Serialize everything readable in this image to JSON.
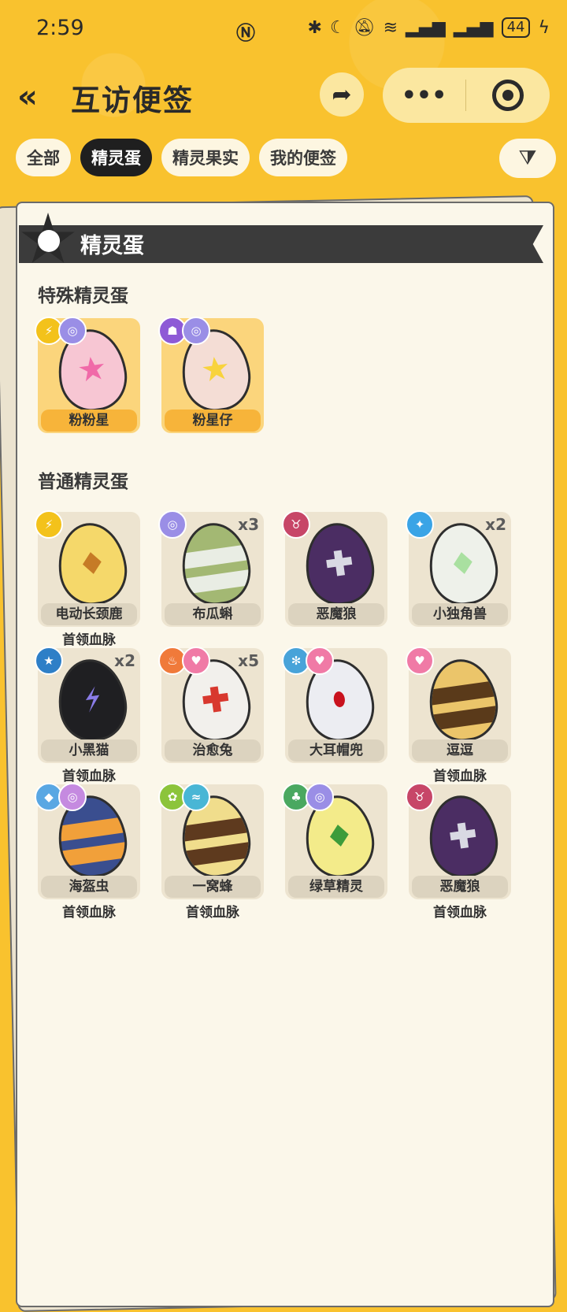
{
  "status_bar": {
    "time": "2:59",
    "battery": "44",
    "icons": [
      "nfc-icon",
      "bluetooth-icon",
      "moon-icon",
      "bell-off-icon",
      "wifi-icon",
      "signal-icon",
      "signal-icon",
      "battery-icon",
      "charging-icon"
    ]
  },
  "header": {
    "back_glyph": "«",
    "title": "互访便签",
    "share_glyph": "➦",
    "more_glyph": "•••"
  },
  "tabs": [
    {
      "label": "全部",
      "active": false
    },
    {
      "label": "精灵蛋",
      "active": true
    },
    {
      "label": "精灵果实",
      "active": false
    },
    {
      "label": "我的便签",
      "active": false
    }
  ],
  "filter_glyph": "⧩",
  "section": {
    "title": "精灵蛋",
    "special_title": "特殊精灵蛋",
    "normal_title": "普通精灵蛋"
  },
  "special_eggs": [
    {
      "name": "粉粉星",
      "badges": [
        {
          "icon": "electric-icon",
          "color": "#f3c21b",
          "glyph": "⚡"
        },
        {
          "icon": "spiral-icon",
          "color": "#9a8ee6",
          "glyph": "◎"
        }
      ],
      "egg_color": "#f7c6d3",
      "mark_color": "#f06aa8",
      "mark": "star"
    },
    {
      "name": "粉星仔",
      "badges": [
        {
          "icon": "ghost-icon",
          "color": "#8e5ad6",
          "glyph": "☗"
        },
        {
          "icon": "spiral-icon",
          "color": "#9a8ee6",
          "glyph": "◎"
        }
      ],
      "egg_color": "#f4ddd5",
      "mark_color": "#f8d33d",
      "mark": "star"
    }
  ],
  "normal_eggs": [
    {
      "name": "电动长颈鹿",
      "bloodline": "首领血脉",
      "count": "",
      "badges": [
        {
          "icon": "electric-icon",
          "color": "#f3c21b",
          "glyph": "⚡"
        }
      ],
      "egg_color": "#f5d86a",
      "mark_color": "#c67b26",
      "mark": "diamond"
    },
    {
      "name": "布瓜蝌",
      "bloodline": "",
      "count": "x3",
      "badges": [
        {
          "icon": "spiral-icon",
          "color": "#9a8ee6",
          "glyph": "◎"
        }
      ],
      "egg_color": "#a3b873",
      "mark_color": "#e9ede4",
      "mark": "band"
    },
    {
      "name": "恶魔狼",
      "bloodline": "",
      "count": "",
      "badges": [
        {
          "icon": "demon-icon",
          "color": "#c74668",
          "glyph": "♉"
        }
      ],
      "egg_color": "#4b2d63",
      "mark_color": "#d9d9e3",
      "mark": "cross"
    },
    {
      "name": "小独角兽",
      "bloodline": "",
      "count": "x2",
      "badges": [
        {
          "icon": "sparkle-icon",
          "color": "#3aa4e6",
          "glyph": "✦"
        }
      ],
      "egg_color": "#eef1ea",
      "mark_color": "#a9e0a0",
      "mark": "diamond"
    },
    {
      "name": "小黑猫",
      "bloodline": "首领血脉",
      "count": "x2",
      "badges": [
        {
          "icon": "star-badge-icon",
          "color": "#2e7fc7",
          "glyph": "★"
        }
      ],
      "egg_color": "#1f1f22",
      "mark_color": "#8a7ce8",
      "mark": "bolt"
    },
    {
      "name": "治愈兔",
      "bloodline": "",
      "count": "x5",
      "badges": [
        {
          "icon": "fire-icon",
          "color": "#f07a3a",
          "glyph": "♨"
        },
        {
          "icon": "heart-icon",
          "color": "#f07aa6",
          "glyph": "♥"
        }
      ],
      "egg_color": "#f2f0ec",
      "mark_color": "#d8382e",
      "mark": "cross"
    },
    {
      "name": "大耳帽兜",
      "bloodline": "",
      "count": "",
      "badges": [
        {
          "icon": "snowflake-icon",
          "color": "#48a3d9",
          "glyph": "✻"
        },
        {
          "icon": "heart-icon",
          "color": "#f07aa6",
          "glyph": "♥"
        }
      ],
      "egg_color": "#ecedf2",
      "mark_color": "#c9121e",
      "mark": "dot"
    },
    {
      "name": "逗逗",
      "bloodline": "首领血脉",
      "count": "",
      "badges": [
        {
          "icon": "heart-icon",
          "color": "#f07aa6",
          "glyph": "♥"
        }
      ],
      "egg_color": "#ebc56a",
      "mark_color": "#5a3a1a",
      "mark": "band"
    },
    {
      "name": "海盔虫",
      "bloodline": "首领血脉",
      "count": "",
      "badges": [
        {
          "icon": "water-icon",
          "color": "#59a7e3",
          "glyph": "◆"
        },
        {
          "icon": "spiral-icon",
          "color": "#c58ae0",
          "glyph": "◎"
        }
      ],
      "egg_color": "#3a4e8f",
      "mark_color": "#f1a03a",
      "mark": "band"
    },
    {
      "name": "一窝蜂",
      "bloodline": "首领血脉",
      "count": "",
      "badges": [
        {
          "icon": "bug-icon",
          "color": "#8cc43b",
          "glyph": "✿"
        },
        {
          "icon": "wing-icon",
          "color": "#49b6d5",
          "glyph": "≈"
        }
      ],
      "egg_color": "#f0dd8c",
      "mark_color": "#5e3a1e",
      "mark": "band"
    },
    {
      "name": "绿草精灵",
      "bloodline": "",
      "count": "",
      "badges": [
        {
          "icon": "leaf-icon",
          "color": "#4aa860",
          "glyph": "♣"
        },
        {
          "icon": "spiral-icon",
          "color": "#9a8ee6",
          "glyph": "◎"
        }
      ],
      "egg_color": "#f3eb8a",
      "mark_color": "#3d9c3a",
      "mark": "diamond"
    },
    {
      "name": "恶魔狼",
      "bloodline": "首领血脉",
      "count": "",
      "badges": [
        {
          "icon": "demon-icon",
          "color": "#c74668",
          "glyph": "♉"
        }
      ],
      "egg_color": "#4b2d63",
      "mark_color": "#d9d9e3",
      "mark": "cross"
    }
  ]
}
